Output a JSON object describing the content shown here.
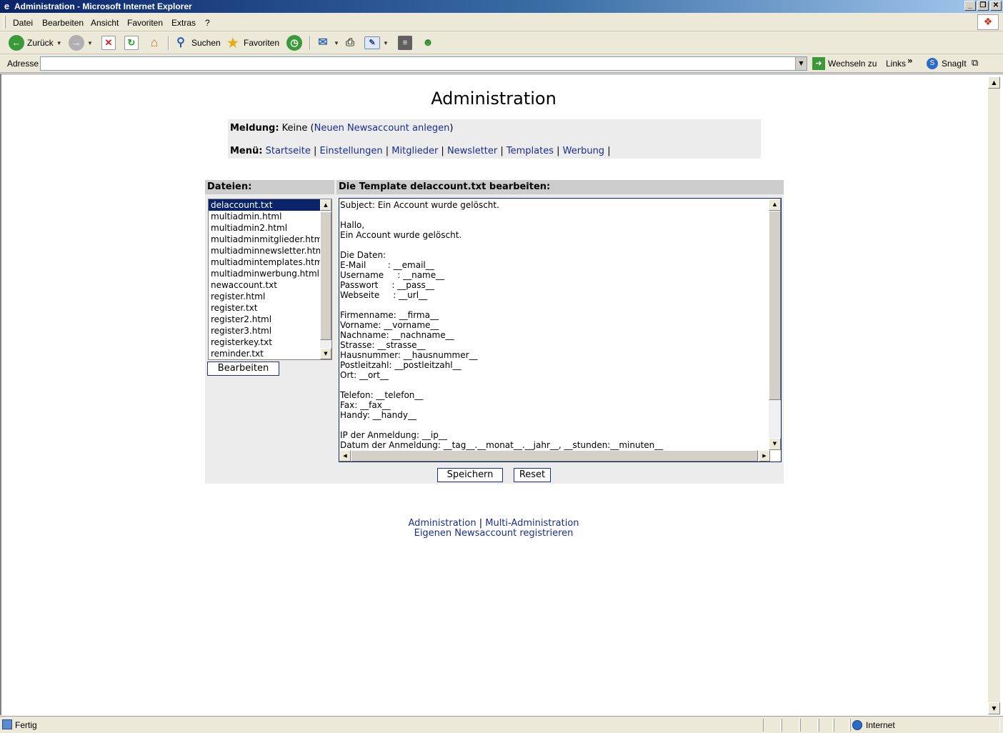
{
  "window": {
    "title": "Administration - Microsoft Internet Explorer",
    "icon": "ie-icon",
    "buttons": [
      "_",
      "❐",
      "✕"
    ]
  },
  "menubar": {
    "items": [
      "Datei",
      "Bearbeiten",
      "Ansicht",
      "Favoriten",
      "Extras",
      "?"
    ]
  },
  "toolbar": {
    "back_label": "Zurück",
    "search_label": "Suchen",
    "favorites_label": "Favoriten"
  },
  "addressbar": {
    "label": "Adresse",
    "value": "",
    "go_label": "Wechseln zu",
    "links_label": "Links",
    "snagit_label": "SnagIt"
  },
  "page": {
    "title": "Administration",
    "message_label": "Meldung:",
    "message_value": "Keine",
    "message_link": "Neuen Newsaccount anlegen",
    "menu_label": "Menü:",
    "menu_items": [
      "Startseite",
      "Einstellungen",
      "Mitglieder",
      "Newsletter",
      "Templates",
      "Werbung"
    ],
    "files_header": "Dateien:",
    "editor_header": "Die Template delaccount.txt bearbeiten:",
    "files": [
      "delaccount.txt",
      "multiadmin.html",
      "multiadmin2.html",
      "multiadminmitglieder.html",
      "multiadminnewsletter.html",
      "multiadmintemplates.html",
      "multiadminwerbung.html",
      "newaccount.txt",
      "register.html",
      "register.txt",
      "register2.html",
      "register3.html",
      "registerkey.txt",
      "reminder.txt"
    ],
    "selected_file": "delaccount.txt",
    "edit_button": "Bearbeiten",
    "template_text": "Subject: Ein Account wurde gelöscht.\n\nHallo,\nEin Account wurde gelöscht.\n\nDie Daten:\nE-Mail        : __email__\nUsername     : __name__\nPasswort     : __pass__\nWebseite     : __url__\n\nFirmenname: __firma__\nVorname: __vorname__\nNachname: __nachname__\nStrasse: __strasse__\nHausnummer: __hausnummer__\nPostleitzahl: __postleitzahl__\nOrt: __ort__\n\nTelefon: __telefon__\nFax: __fax__\nHandy: __handy__\n\nIP der Anmeldung: __ip__\nDatum der Anmeldung: __tag__.__monat__.__jahr__, __stunden:__minuten__",
    "save_button": "Speichern",
    "reset_button": "Reset",
    "footer_link1": "Administration",
    "footer_link2": "Multi-Administration",
    "footer_link3": "Eigenen Newsaccount registrieren"
  },
  "statusbar": {
    "text": "Fertig",
    "zone": "Internet"
  },
  "colors": {
    "link": "#1a2e8a",
    "selection": "#0a246a",
    "panel": "#ececec",
    "header": "#cccccc"
  }
}
